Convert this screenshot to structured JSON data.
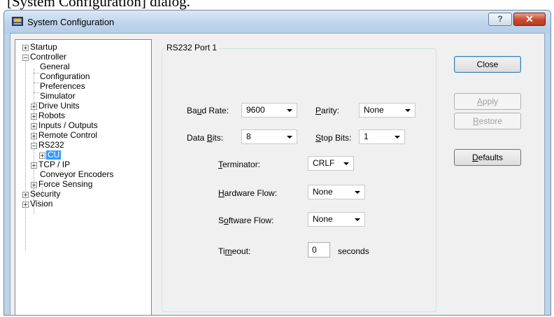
{
  "caption": "[System Configuration] dialog.",
  "window": {
    "title": "System Configuration",
    "help_label": "?",
    "close_label": "✕"
  },
  "tree": {
    "items": {
      "startup": "Startup",
      "controller": "Controller",
      "general": "General",
      "configuration": "Configuration",
      "preferences": "Preferences",
      "simulator": "Simulator",
      "drive_units": "Drive Units",
      "robots": "Robots",
      "inputs_outputs": "Inputs / Outputs",
      "remote_control": "Remote Control",
      "rs232": "RS232",
      "cu": "CU",
      "tcp_ip": "TCP / IP",
      "conveyor_encoders": "Conveyor Encoders",
      "force_sensing": "Force Sensing",
      "security": "Security",
      "vision": "Vision"
    },
    "selected": "CU",
    "expand_plus": "+",
    "expand_minus": "−"
  },
  "group": {
    "title": "RS232 Port 1",
    "baud_rate": {
      "pre": "Ba",
      "mn": "u",
      "post": "d Rate:",
      "value": "9600"
    },
    "parity": {
      "pre": "",
      "mn": "P",
      "post": "arity:",
      "value": "None"
    },
    "data_bits": {
      "pre": "Data ",
      "mn": "B",
      "post": "its:",
      "value": "8"
    },
    "stop_bits": {
      "pre": "",
      "mn": "S",
      "post": "top Bits:",
      "value": "1"
    },
    "terminator": {
      "pre": "",
      "mn": "T",
      "post": "erminator:",
      "value": "CRLF"
    },
    "hardware_flow": {
      "pre": "",
      "mn": "H",
      "post": "ardware Flow:",
      "value": "None"
    },
    "software_flow": {
      "pre": "S",
      "mn": "o",
      "post": "ftware Flow:",
      "value": "None"
    },
    "timeout": {
      "pre": "Ti",
      "mn": "m",
      "post": "eout:",
      "value": "0",
      "unit": "seconds"
    }
  },
  "buttons": {
    "close": "Close",
    "apply": {
      "mn": "A",
      "post": "pply"
    },
    "restore": {
      "mn": "R",
      "post": "estore"
    },
    "defaults": {
      "mn": "D",
      "post": "efaults"
    }
  },
  "colors": {
    "selection": "#3399ff",
    "close_button": "#c9492d",
    "frame": "#bcd3ea"
  }
}
